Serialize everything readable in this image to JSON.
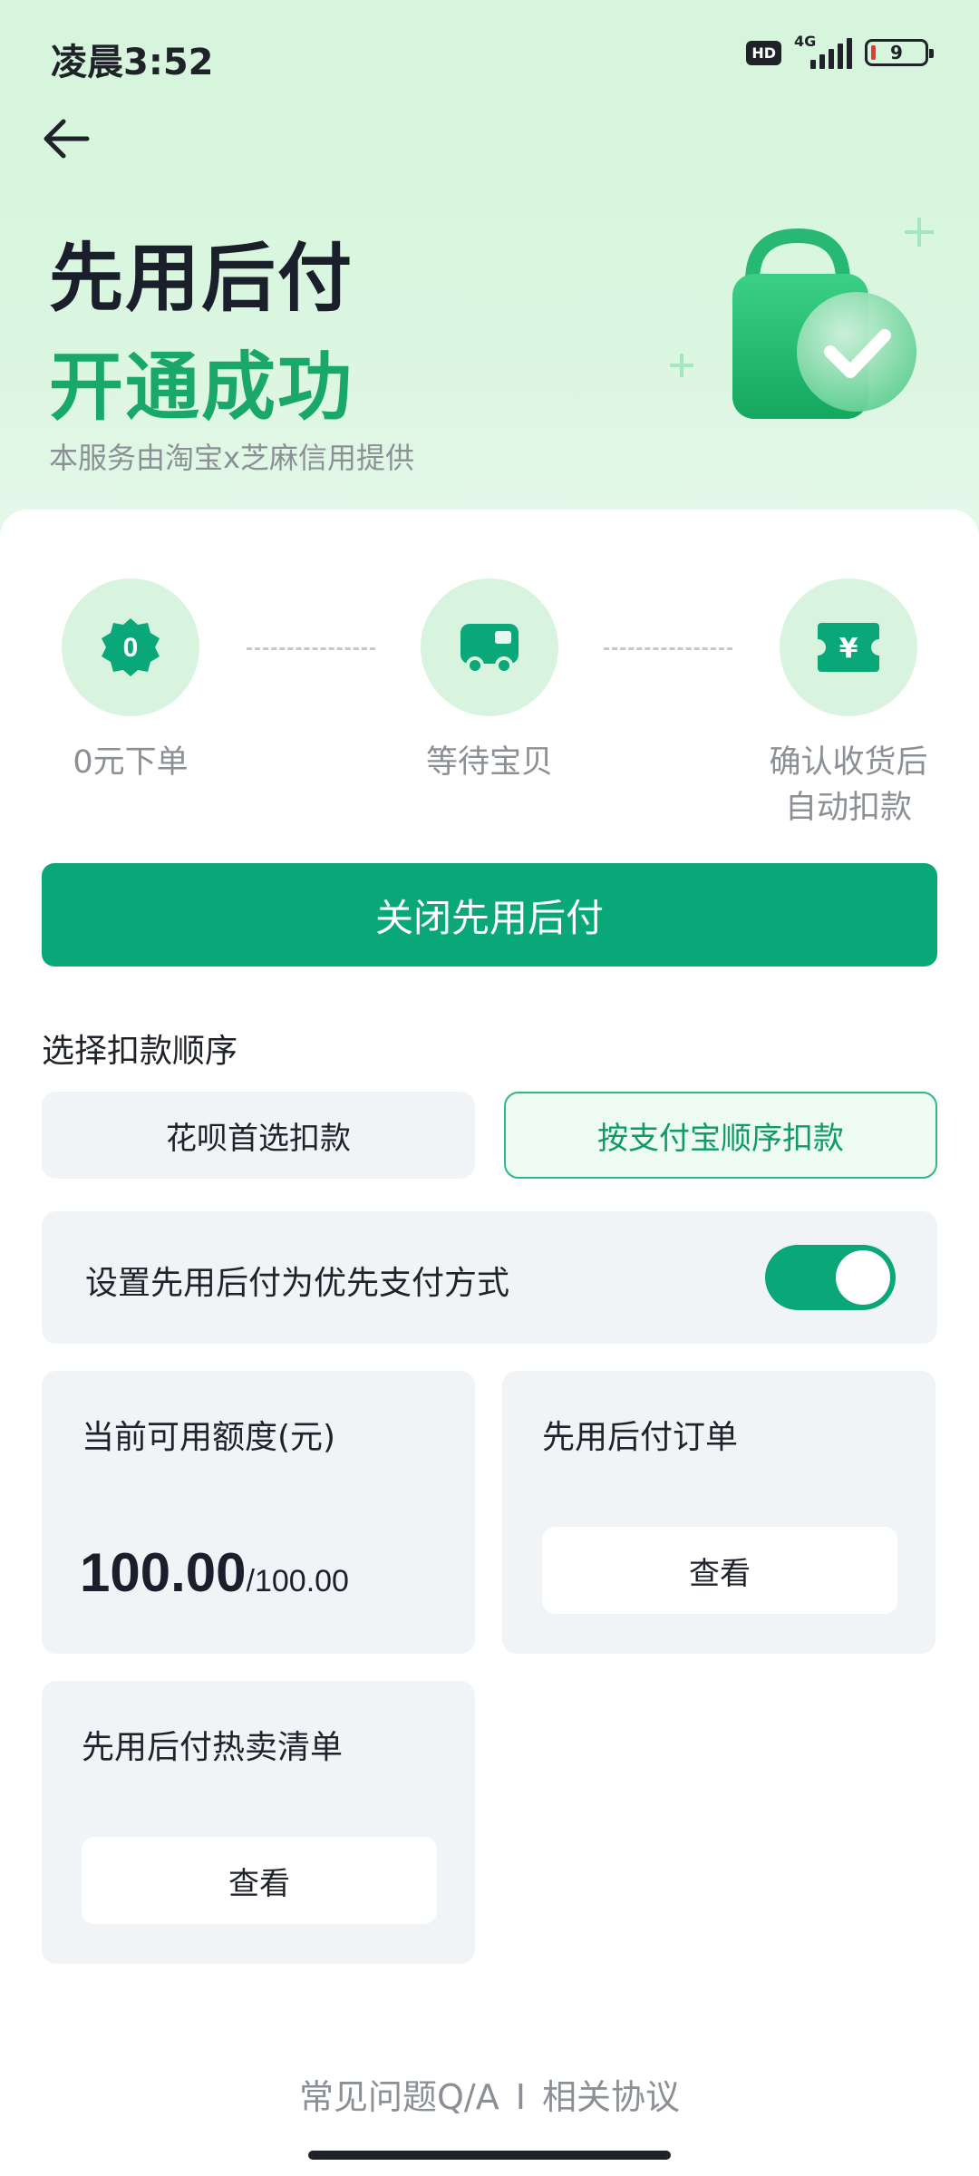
{
  "status": {
    "time": "凌晨3:52",
    "hd": "HD",
    "network": "4G",
    "battery": "9"
  },
  "hero": {
    "title": "先用后付",
    "subtitle_success": "开通成功",
    "provider": "本服务由淘宝x芝麻信用提供"
  },
  "steps": [
    {
      "label": "0元下单",
      "icon": "zero-badge-icon",
      "glyph": "0"
    },
    {
      "label": "等待宝贝",
      "icon": "truck-icon"
    },
    {
      "label_line1": "确认收货后",
      "label_line2": "自动扣款",
      "icon": "yen-ticket-icon",
      "glyph": "¥"
    }
  ],
  "primary_button": "关闭先用后付",
  "deduction": {
    "title": "选择扣款顺序",
    "options": [
      "花呗首选扣款",
      "按支付宝顺序扣款"
    ],
    "selected": "按支付宝顺序扣款"
  },
  "toggle": {
    "label": "设置先用后付为优先支付方式",
    "on": true
  },
  "credit": {
    "title": "当前可用额度(元)",
    "available": "100.00",
    "total": "/100.00"
  },
  "orders": {
    "title": "先用后付订单",
    "button": "查看"
  },
  "hot_list": {
    "title": "先用后付热卖清单",
    "button": "查看"
  },
  "footer": {
    "faq": "常见问题Q/A",
    "separator": "I",
    "agreement": "相关协议"
  },
  "colors": {
    "accent": "#0aa878",
    "hero_bg": "#d6f5dc",
    "success_text": "#1aa86a",
    "tile_bg": "#f1f4f7"
  }
}
